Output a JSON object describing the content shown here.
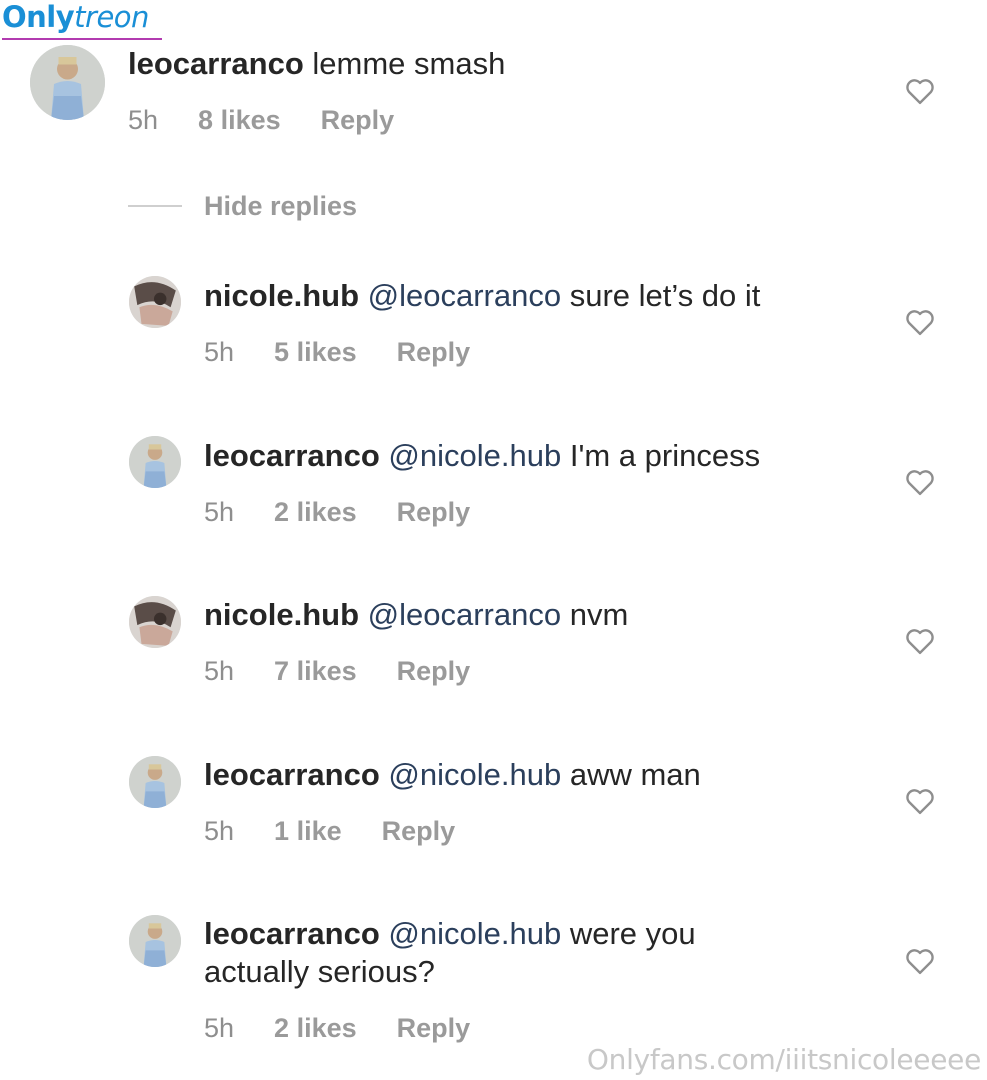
{
  "logo": {
    "part1": "Only",
    "part2": "treon"
  },
  "top_comment": {
    "username": "leocarranco",
    "text": "lemme smash",
    "time": "5h",
    "likes": "8 likes",
    "reply": "Reply"
  },
  "hide_replies_label": "Hide replies",
  "replies": [
    {
      "username": "nicole.hub",
      "mention": "@leocarranco",
      "text": "sure let’s do it",
      "time": "5h",
      "likes": "5 likes",
      "reply": "Reply"
    },
    {
      "username": "leocarranco",
      "mention": "@nicole.hub",
      "text": "I'm a princess",
      "time": "5h",
      "likes": "2 likes",
      "reply": "Reply"
    },
    {
      "username": "nicole.hub",
      "mention": "@leocarranco",
      "text": "nvm",
      "time": "5h",
      "likes": "7 likes",
      "reply": "Reply"
    },
    {
      "username": "leocarranco",
      "mention": "@nicole.hub",
      "text": "aww man",
      "time": "5h",
      "likes": "1 like",
      "reply": "Reply"
    },
    {
      "username": "leocarranco",
      "mention": "@nicole.hub",
      "text": "were you",
      "text_line2": "actually serious?",
      "time": "5h",
      "likes": "2 likes",
      "reply": "Reply"
    }
  ],
  "watermark": "Onlyfans.com/iiitsnicoleeeee",
  "colors": {
    "mention": "#2b3f5c",
    "meta": "#8e8e8e",
    "logo": "#1a8fd6",
    "logo_underline": "#b23bb0"
  }
}
